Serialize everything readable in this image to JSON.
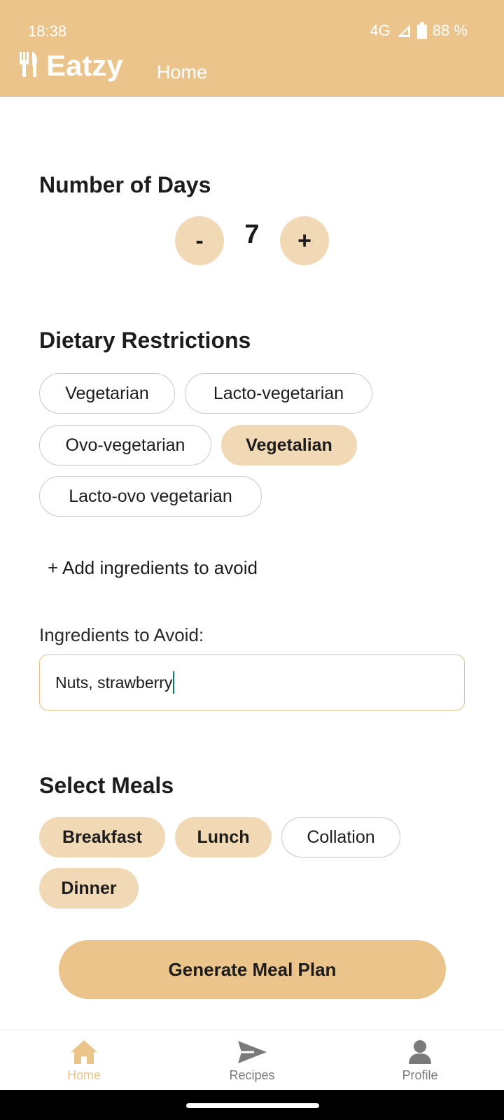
{
  "status_bar": {
    "time": "18:38",
    "network": "4G",
    "battery": "88 %"
  },
  "header": {
    "brand": "Eatzy",
    "page": "Home",
    "icon": "fork-knife-icon"
  },
  "days": {
    "title": "Number of Days",
    "decrement_label": "-",
    "value": "7",
    "increment_label": "+"
  },
  "dietary": {
    "title": "Dietary Restrictions",
    "options": [
      {
        "label": "Vegetarian",
        "selected": false
      },
      {
        "label": "Lacto-vegetarian",
        "selected": false
      },
      {
        "label": "Ovo-vegetarian",
        "selected": false
      },
      {
        "label": "Vegetalian",
        "selected": true
      },
      {
        "label": "Lacto-ovo vegetarian",
        "selected": false
      }
    ]
  },
  "avoid": {
    "add_link": "+ Add ingredients to avoid",
    "label": "Ingredients to Avoid:",
    "value": "Nuts, strawberry"
  },
  "meals": {
    "title": "Select Meals",
    "options": [
      {
        "label": "Breakfast",
        "selected": true
      },
      {
        "label": "Lunch",
        "selected": true
      },
      {
        "label": "Collation",
        "selected": false
      },
      {
        "label": "Dinner",
        "selected": true
      }
    ]
  },
  "generate_button": "Generate Meal Plan",
  "bottom_nav": {
    "items": [
      {
        "label": "Home",
        "icon": "home-icon",
        "active": true
      },
      {
        "label": "Recipes",
        "icon": "send-icon",
        "active": false
      },
      {
        "label": "Profile",
        "icon": "user-icon",
        "active": false
      }
    ]
  },
  "colors": {
    "accent": "#ebc48c",
    "chip_selected": "#f1d9b6",
    "input_border": "#e6be83",
    "caret": "#0f7a70"
  }
}
